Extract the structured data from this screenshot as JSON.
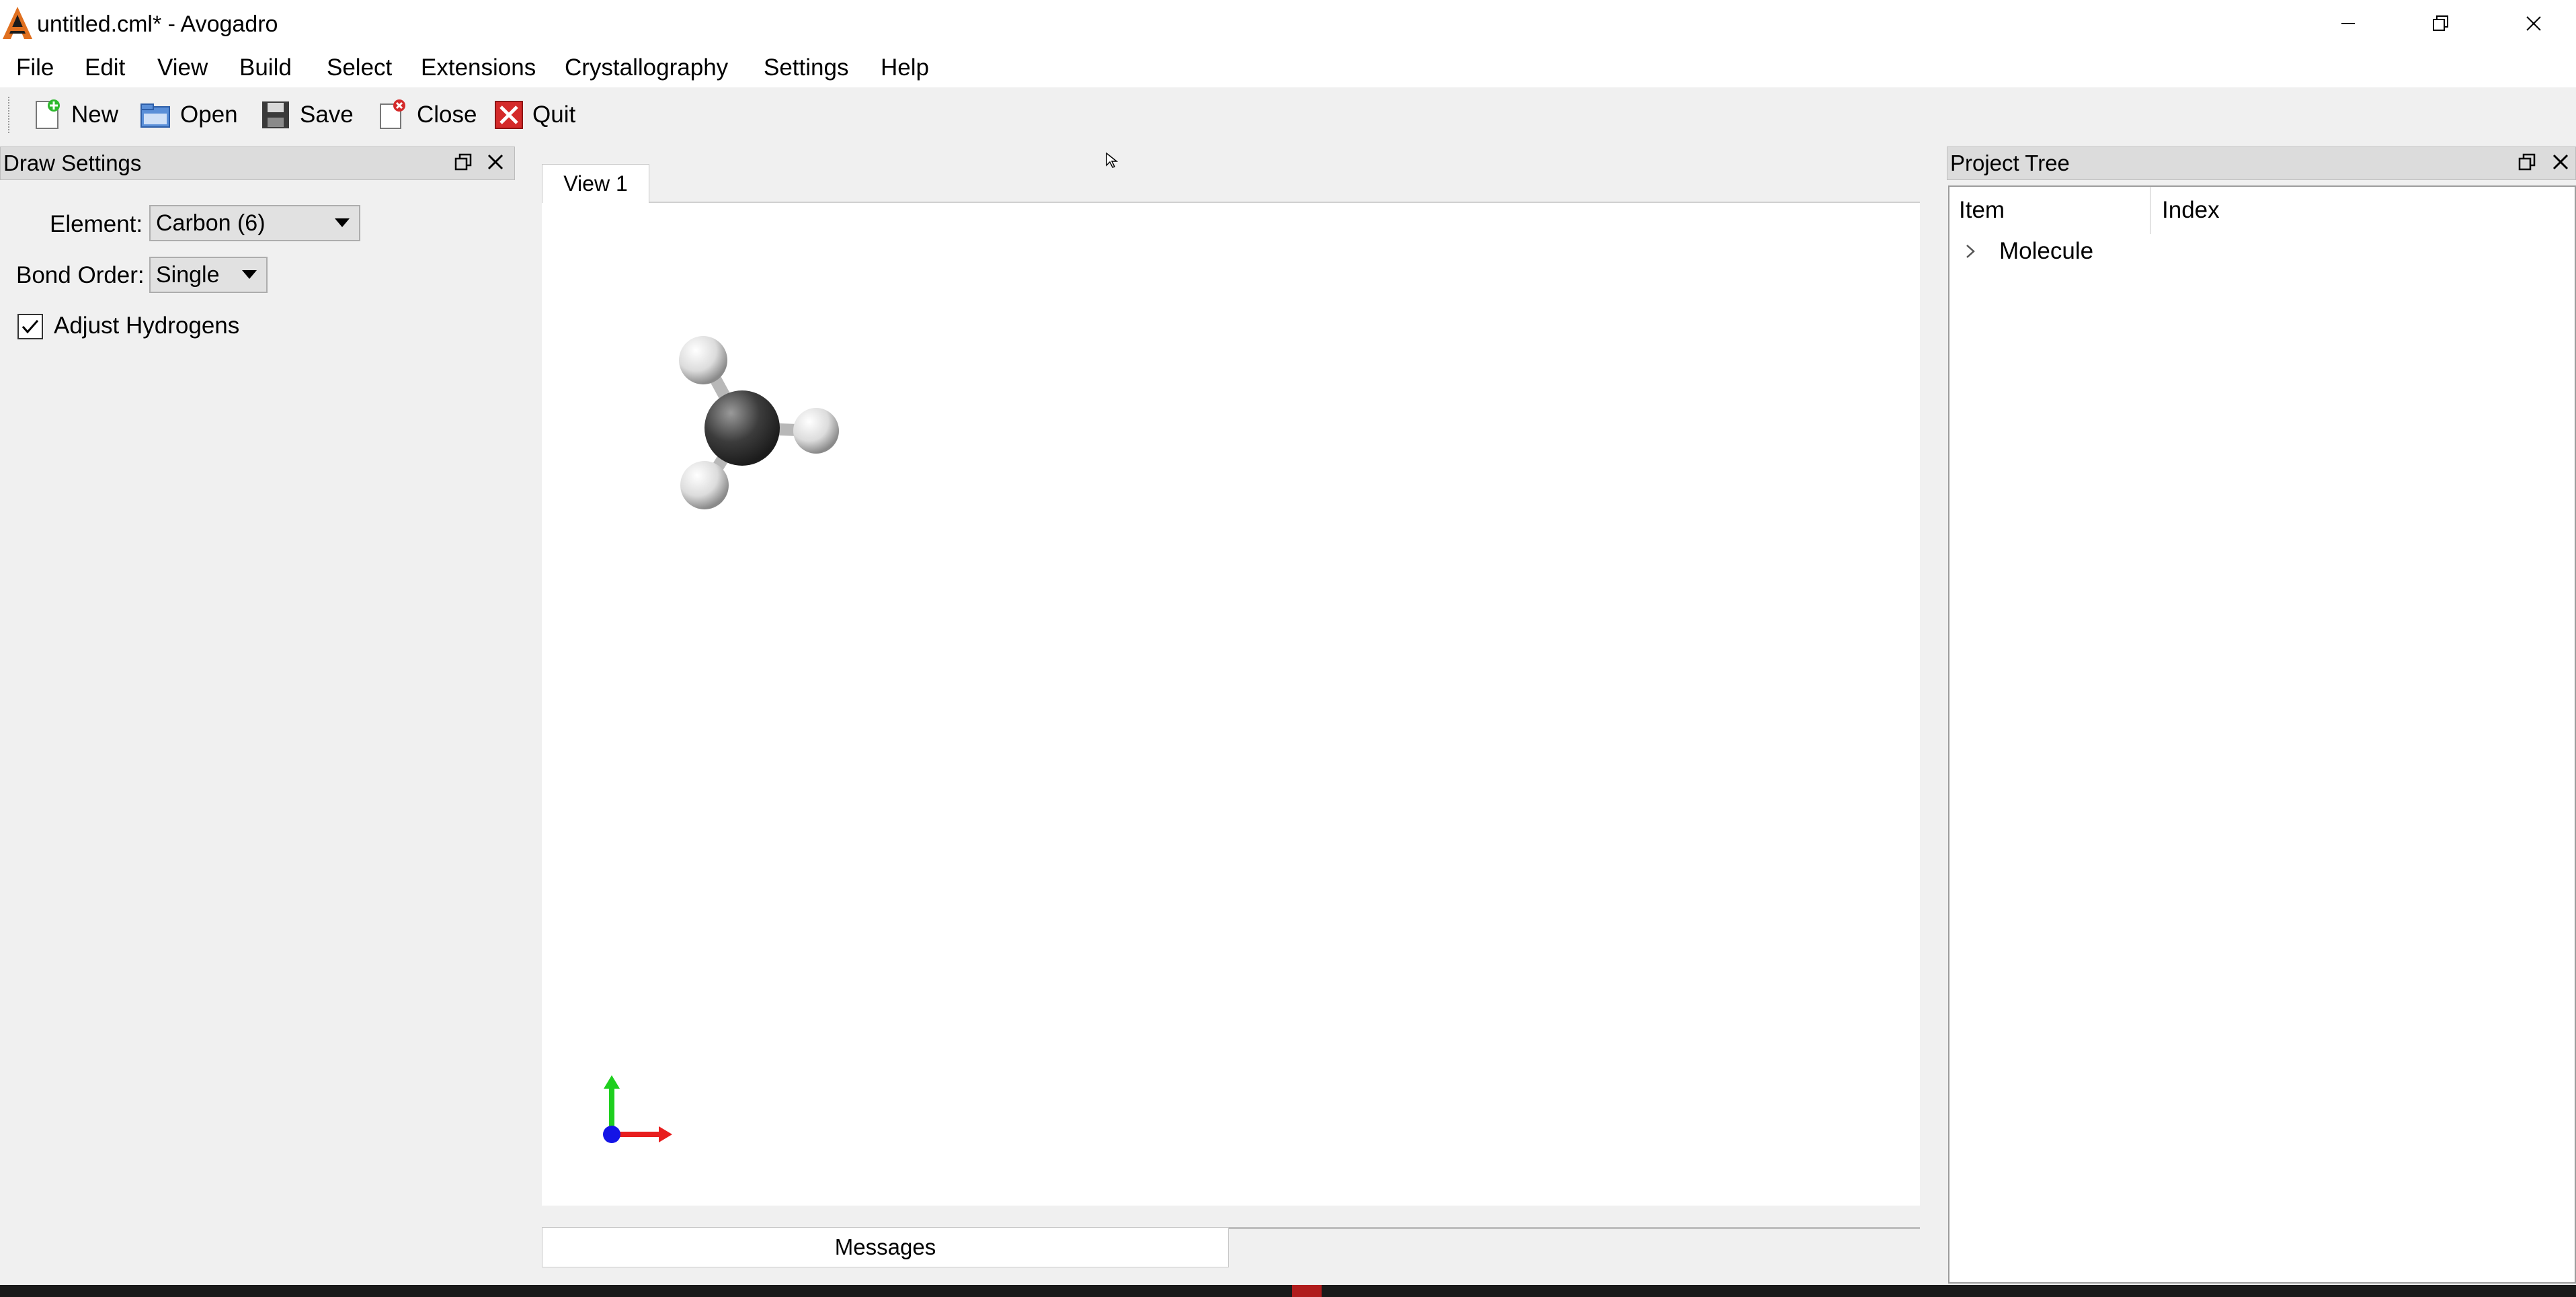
{
  "window": {
    "title": "untitled.cml* - Avogadro"
  },
  "menu": {
    "file": "File",
    "edit": "Edit",
    "view": "View",
    "build": "Build",
    "select": "Select",
    "extensions": "Extensions",
    "crystallography": "Crystallography",
    "settings": "Settings",
    "help": "Help"
  },
  "toolbar": {
    "new": "New",
    "open": "Open",
    "save": "Save",
    "close": "Close",
    "quit": "Quit"
  },
  "draw_settings": {
    "title": "Draw Settings",
    "element_label": "Element:",
    "element_value": "Carbon (6)",
    "bond_order_label": "Bond Order:",
    "bond_order_value": "Single",
    "adjust_hydrogens_label": "Adjust Hydrogens",
    "adjust_hydrogens_checked": true
  },
  "view": {
    "tab_label": "View 1"
  },
  "messages": {
    "tab_label": "Messages"
  },
  "project_tree": {
    "title": "Project Tree",
    "columns": [
      "Item",
      "Index"
    ],
    "rows": [
      {
        "item": "Molecule",
        "index": ""
      }
    ]
  },
  "colors": {
    "axis_x": "#e81e1e",
    "axis_y": "#1ecf1e",
    "axis_z": "#1414e6",
    "carbon": "#3c3c3c",
    "hydrogen": "#e6e6e6",
    "quit_red": "#d42a2a"
  }
}
